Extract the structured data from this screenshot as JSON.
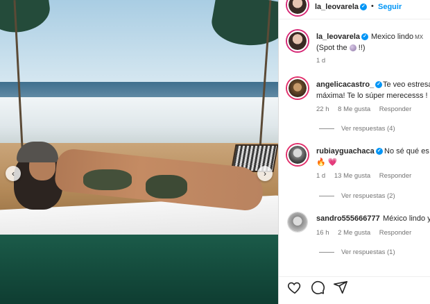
{
  "post": {
    "username": "la_leovarela",
    "follow_label": "Seguir",
    "separator": "•"
  },
  "caption": {
    "username": "la_leovarela",
    "text_line1": "Mexico lindo",
    "flag_text": "MX",
    "text_line2_prefix": "(Spot the",
    "text_line2_suffix": " !!)",
    "time": "1 d"
  },
  "comments": [
    {
      "username": "angelicacastro_",
      "text_line1": "Te veo estresa",
      "text_line2": "máxima! Te lo súper merecesss !",
      "time": "22 h",
      "likes": "8 Me gusta",
      "reply_label": "Responder",
      "replies_label": "Ver respuestas (4)"
    },
    {
      "username": "rubiayguachaca",
      "text_line1": "No sé qué es",
      "text_line2": "🔥 💗",
      "time": "1 d",
      "likes": "13 Me gusta",
      "reply_label": "Responder",
      "replies_label": "Ver respuestas (2)"
    },
    {
      "username": "sandro555666777",
      "text_line1": "México lindo y",
      "time": "16 h",
      "likes": "2 Me gusta",
      "reply_label": "Responder",
      "replies_label": "Ver respuestas (1)"
    }
  ],
  "carousel": {
    "prev_label": "‹",
    "next_label": "›"
  },
  "colors": {
    "accent": "#0095f6",
    "story_ring": "#d62976",
    "muted_text": "#737373"
  },
  "icons": [
    "like-icon",
    "comment-icon",
    "share-icon",
    "verified-icon",
    "heart-icon"
  ]
}
